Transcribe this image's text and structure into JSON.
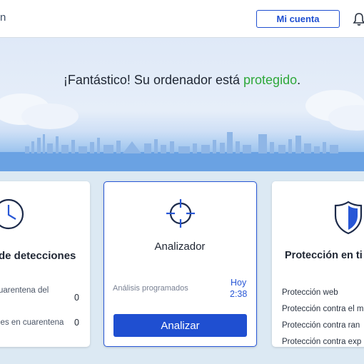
{
  "topbar": {
    "title_fragment": "n",
    "account_button": "Mi cuenta"
  },
  "hero": {
    "headline_prefix": "¡Fantástico! Su ordenador está ",
    "headline_status": "protegido",
    "headline_suffix": "."
  },
  "cards": {
    "detections": {
      "title": "de detecciones",
      "rows": [
        {
          "label": "uarentena del",
          "value": "0"
        },
        {
          "label": "les en cuarentena",
          "value": "0"
        }
      ]
    },
    "scanner": {
      "title": "Analizador",
      "scheduled_label": "Análisis programados",
      "scheduled_day": "Hoy",
      "scheduled_time": "2:38",
      "scan_button": "Analizar"
    },
    "protection": {
      "title": "Protección en ti",
      "items": [
        "Protección web",
        "Protección contra el m",
        "Protección contra ran",
        "Protección contra exp"
      ]
    }
  },
  "colors": {
    "accent": "#1f4fd1",
    "ok_green": "#2ea83a"
  },
  "icons": {
    "clock": "clock-icon",
    "crosshair": "crosshair-icon",
    "shield": "shield-icon",
    "bell": "bell-icon"
  }
}
